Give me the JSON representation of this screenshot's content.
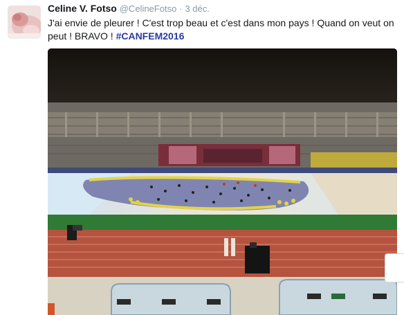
{
  "tweet": {
    "display_name": "Celine V. Fotso",
    "handle": "@CelineFotso",
    "separator": "·",
    "timestamp": "3 déc.",
    "text": "J'ai envie de pleurer ! C'est trop beau et c'est dans mon pays ! Quand on veut on peut ! BRAVO ! ",
    "hashtag": "#CANFEM2016",
    "avatar_icon": "baby-hand-photo",
    "media_icon": "stadium-ceremony-photo"
  },
  "colors": {
    "hashtag": "#2b3a9e",
    "muted": "#8899a6",
    "text": "#14171a",
    "track": "#b5533f",
    "pitch": "#2f7a34"
  }
}
